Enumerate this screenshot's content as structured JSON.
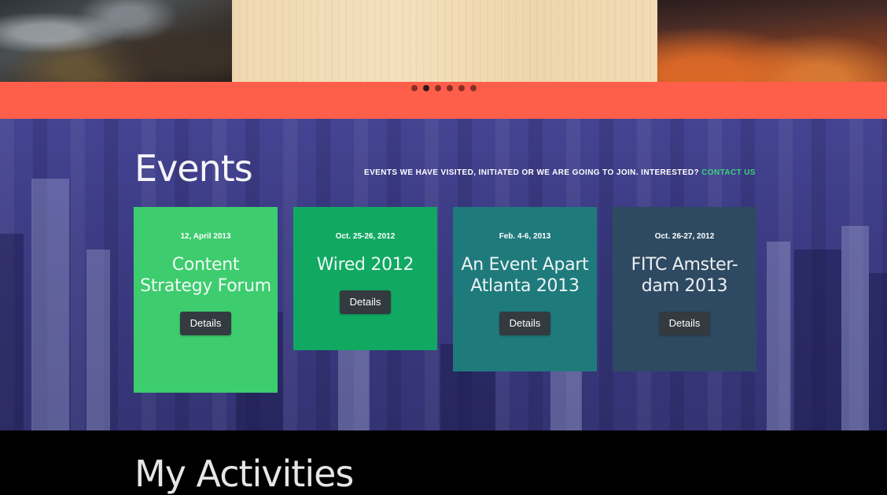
{
  "slider": {
    "slides": [
      "rocky-coast-image",
      "wood-texture-image",
      "sunset-beach-image"
    ],
    "dot_count": 6,
    "active_index": 1,
    "bar_color": "#ff5e4a"
  },
  "events": {
    "title": "Events",
    "tagline": "EVENTS WE HAVE VISITED, INITIATED OR WE ARE GOING TO JOIN. INTERESTED?",
    "contact_label": "CONTACT US",
    "contact_color": "#3dd27a",
    "cards": [
      {
        "date": "12, April 2013",
        "name": "Content Strategy Forum",
        "button": "Details",
        "color": "#3dcc6e"
      },
      {
        "date": "Oct. 25-26, 2012",
        "name": "Wired 2012",
        "button": "Details",
        "color": "#11a962"
      },
      {
        "date": "Feb. 4-6, 2013",
        "name": "An Event Apart Atlanta 2013",
        "button": "Details",
        "color": "#1f7a7c"
      },
      {
        "date": "Oct. 26-27, 2012",
        "name": "FITC Amster-dam 2013",
        "button": "Details",
        "color": "#2e4a62"
      }
    ]
  },
  "activities": {
    "title": "My Activities"
  }
}
